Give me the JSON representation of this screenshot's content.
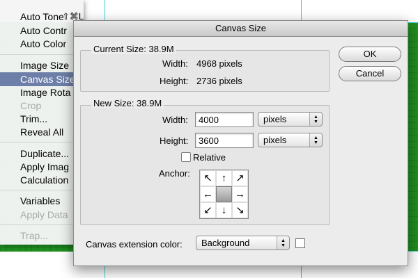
{
  "menu": {
    "items": [
      {
        "label": "Auto Tone",
        "shortcut": "⇧⌘L",
        "state": "normal"
      },
      {
        "label": "Auto Contr",
        "shortcut": "",
        "state": "normal"
      },
      {
        "label": "Auto Color",
        "shortcut": "",
        "state": "normal"
      },
      {
        "label": "Image Size",
        "shortcut": "",
        "state": "normal"
      },
      {
        "label": "Canvas Size",
        "shortcut": "",
        "state": "selected"
      },
      {
        "label": "Image Rota",
        "shortcut": "",
        "state": "normal"
      },
      {
        "label": "Crop",
        "shortcut": "",
        "state": "disabled"
      },
      {
        "label": "Trim...",
        "shortcut": "",
        "state": "normal"
      },
      {
        "label": "Reveal All",
        "shortcut": "",
        "state": "normal"
      },
      {
        "label": "Duplicate...",
        "shortcut": "",
        "state": "normal"
      },
      {
        "label": "Apply Imag",
        "shortcut": "",
        "state": "normal"
      },
      {
        "label": "Calculation",
        "shortcut": "",
        "state": "normal"
      },
      {
        "label": "Variables",
        "shortcut": "",
        "state": "normal"
      },
      {
        "label": "Apply Data",
        "shortcut": "",
        "state": "disabled"
      },
      {
        "label": "Trap...",
        "shortcut": "",
        "state": "disabled"
      }
    ]
  },
  "dialog": {
    "title": "Canvas Size",
    "current_size": {
      "heading": "Current Size: 38.9M",
      "width_label": "Width:",
      "width_value": "4968 pixels",
      "height_label": "Height:",
      "height_value": "2736 pixels"
    },
    "new_size": {
      "heading": "New Size: 38.9M",
      "width_label": "Width:",
      "width_value": "4000",
      "width_unit": "pixels",
      "height_label": "Height:",
      "height_value": "3600",
      "height_unit": "pixels",
      "relative_label": "Relative",
      "relative_checked": false,
      "anchor_label": "Anchor:",
      "anchor_arrows": [
        "↖",
        "↑",
        "↗",
        "←",
        "",
        "→",
        "↙",
        "↓",
        "↘"
      ]
    },
    "extension": {
      "label": "Canvas extension color:",
      "value": "Background",
      "swatch_color": "#ffffff"
    },
    "buttons": {
      "ok": "OK",
      "cancel": "Cancel"
    }
  },
  "colors": {
    "canvas_green": "#1f8f1f",
    "guide_cyan": "#3fd2d2",
    "menu_highlight": "#6d7fa8"
  }
}
